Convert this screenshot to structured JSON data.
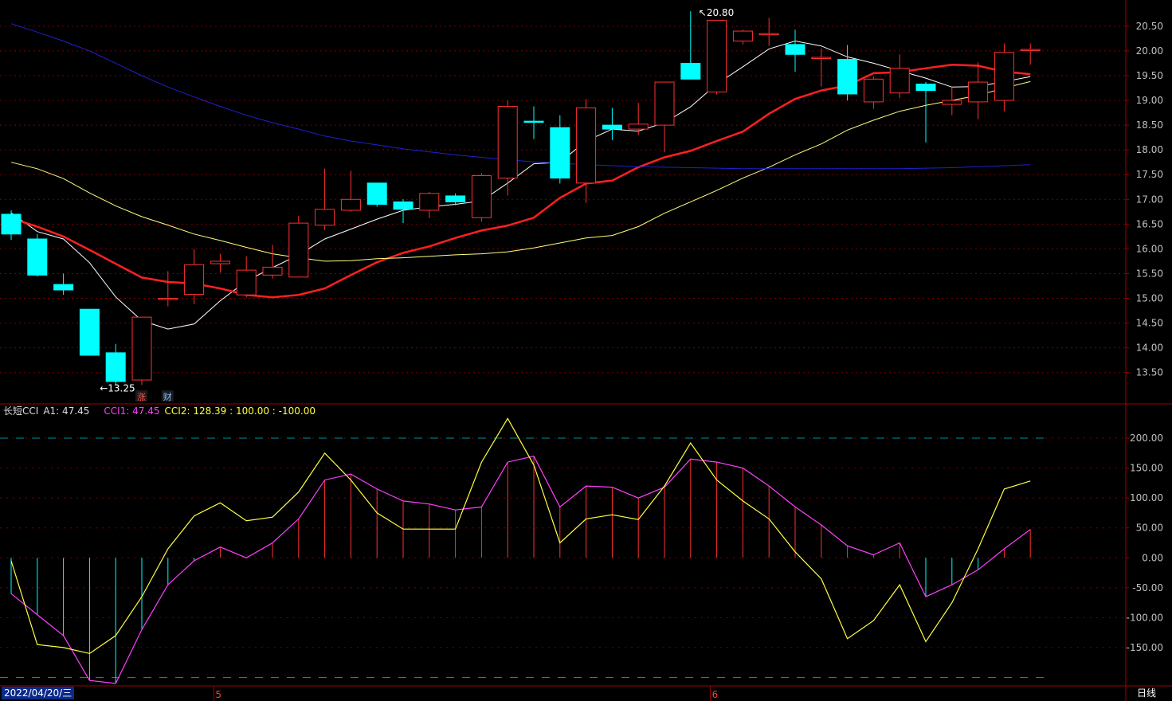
{
  "chart_data": [
    {
      "type": "candlestick",
      "name": "price",
      "y_ticks": [
        13.5,
        14.0,
        14.5,
        15.0,
        15.5,
        16.0,
        16.5,
        17.0,
        17.5,
        18.0,
        18.5,
        19.0,
        19.5,
        20.0,
        20.5
      ],
      "ylim": [
        12.9,
        20.9
      ],
      "candles": [
        {
          "o": 16.7,
          "h": 16.78,
          "c": 16.3,
          "l": 16.18
        },
        {
          "o": 16.2,
          "h": 16.3,
          "c": 15.47,
          "l": 15.44
        },
        {
          "o": 15.28,
          "h": 15.5,
          "c": 15.17,
          "l": 15.07
        },
        {
          "o": 14.78,
          "h": 14.78,
          "c": 13.85,
          "l": 13.85
        },
        {
          "o": 13.9,
          "h": 14.08,
          "c": 13.32,
          "l": 13.25
        },
        {
          "o": 13.35,
          "h": 14.62,
          "c": 14.62,
          "l": 13.25
        },
        {
          "o": 15.0,
          "h": 15.55,
          "c": 15.0,
          "l": 14.84
        },
        {
          "o": 15.08,
          "h": 16.0,
          "c": 15.68,
          "l": 14.88
        },
        {
          "o": 15.7,
          "h": 15.9,
          "c": 15.75,
          "l": 15.52
        },
        {
          "o": 15.07,
          "h": 15.85,
          "c": 15.57,
          "l": 15.02
        },
        {
          "o": 15.47,
          "h": 16.08,
          "c": 15.63,
          "l": 15.4
        },
        {
          "o": 15.43,
          "h": 16.67,
          "c": 16.52,
          "l": 15.43
        },
        {
          "o": 16.48,
          "h": 17.62,
          "c": 16.8,
          "l": 16.38
        },
        {
          "o": 16.78,
          "h": 17.58,
          "c": 17.0,
          "l": 16.75
        },
        {
          "o": 17.33,
          "h": 17.33,
          "c": 16.9,
          "l": 16.85
        },
        {
          "o": 16.95,
          "h": 17.0,
          "c": 16.8,
          "l": 16.52
        },
        {
          "o": 16.78,
          "h": 17.15,
          "c": 17.12,
          "l": 16.62
        },
        {
          "o": 17.07,
          "h": 17.12,
          "c": 16.95,
          "l": 16.88
        },
        {
          "o": 16.63,
          "h": 17.53,
          "c": 17.48,
          "l": 16.55
        },
        {
          "o": 17.43,
          "h": 19.0,
          "c": 18.88,
          "l": 17.08
        },
        {
          "o": 18.58,
          "h": 18.88,
          "c": 18.57,
          "l": 18.22
        },
        {
          "o": 18.45,
          "h": 18.7,
          "c": 17.43,
          "l": 17.32
        },
        {
          "o": 17.33,
          "h": 19.03,
          "c": 18.85,
          "l": 16.93
        },
        {
          "o": 18.5,
          "h": 18.85,
          "c": 18.42,
          "l": 18.2
        },
        {
          "o": 18.42,
          "h": 18.95,
          "c": 18.52,
          "l": 18.3
        },
        {
          "o": 18.5,
          "h": 19.37,
          "c": 19.37,
          "l": 17.95
        },
        {
          "o": 19.75,
          "h": 20.8,
          "c": 19.43,
          "l": 19.43
        },
        {
          "o": 19.17,
          "h": 20.62,
          "c": 20.62,
          "l": 19.12
        },
        {
          "o": 20.2,
          "h": 20.43,
          "c": 20.4,
          "l": 20.13
        },
        {
          "o": 20.35,
          "h": 20.67,
          "c": 20.35,
          "l": 20.1
        },
        {
          "o": 20.13,
          "h": 20.43,
          "c": 19.93,
          "l": 19.58
        },
        {
          "o": 19.87,
          "h": 20.05,
          "c": 19.87,
          "l": 19.28
        },
        {
          "o": 19.83,
          "h": 20.12,
          "c": 19.13,
          "l": 19.0
        },
        {
          "o": 18.97,
          "h": 19.48,
          "c": 19.43,
          "l": 18.83
        },
        {
          "o": 19.15,
          "h": 19.93,
          "c": 19.65,
          "l": 19.05
        },
        {
          "o": 19.33,
          "h": 19.37,
          "c": 19.2,
          "l": 18.15
        },
        {
          "o": 18.92,
          "h": 19.27,
          "c": 19.0,
          "l": 18.7
        },
        {
          "o": 18.97,
          "h": 19.77,
          "c": 19.37,
          "l": 18.62
        },
        {
          "o": 19.0,
          "h": 20.15,
          "c": 19.97,
          "l": 18.78
        },
        {
          "o": 20.03,
          "h": 20.15,
          "c": 20.03,
          "l": 19.72
        }
      ],
      "ma": [
        {
          "color": "#ffffff",
          "width": 1,
          "values": [
            16.73,
            16.35,
            16.2,
            15.72,
            15.03,
            14.55,
            14.38,
            14.48,
            14.95,
            15.35,
            15.62,
            15.88,
            16.2,
            16.4,
            16.6,
            16.78,
            16.85,
            16.9,
            16.97,
            17.33,
            17.72,
            17.75,
            18.18,
            18.42,
            18.38,
            18.55,
            18.87,
            19.33,
            19.68,
            20.04,
            20.2,
            20.1,
            19.88,
            19.75,
            19.6,
            19.45,
            19.27,
            19.28,
            19.38,
            19.48
          ]
        },
        {
          "color": "#ff2020",
          "width": 2.5,
          "values": [
            16.62,
            16.45,
            16.25,
            15.98,
            15.7,
            15.42,
            15.33,
            15.3,
            15.2,
            15.07,
            15.02,
            15.07,
            15.2,
            15.47,
            15.73,
            15.92,
            16.05,
            16.22,
            16.37,
            16.47,
            16.63,
            17.03,
            17.32,
            17.38,
            17.65,
            17.85,
            17.98,
            18.18,
            18.37,
            18.73,
            19.03,
            19.2,
            19.3,
            19.55,
            19.57,
            19.65,
            19.72,
            19.7,
            19.58,
            19.53
          ]
        },
        {
          "color": "#ffff80",
          "width": 1,
          "values": [
            17.75,
            17.62,
            17.42,
            17.13,
            16.87,
            16.65,
            16.48,
            16.3,
            16.17,
            16.03,
            15.9,
            15.82,
            15.75,
            15.76,
            15.8,
            15.82,
            15.85,
            15.88,
            15.9,
            15.94,
            16.02,
            16.12,
            16.22,
            16.27,
            16.45,
            16.72,
            16.95,
            17.18,
            17.43,
            17.65,
            17.9,
            18.12,
            18.4,
            18.6,
            18.78,
            18.9,
            19.0,
            19.1,
            19.25,
            19.38
          ]
        },
        {
          "color": "#2020d0",
          "width": 1,
          "values": [
            20.55,
            20.38,
            20.2,
            20.0,
            19.75,
            19.5,
            19.27,
            19.07,
            18.88,
            18.7,
            18.55,
            18.42,
            18.28,
            18.18,
            18.1,
            18.02,
            17.96,
            17.9,
            17.85,
            17.8,
            17.76,
            17.73,
            17.7,
            17.68,
            17.66,
            17.65,
            17.64,
            17.63,
            17.62,
            17.62,
            17.62,
            17.62,
            17.62,
            17.62,
            17.62,
            17.63,
            17.64,
            17.66,
            17.68,
            17.7
          ]
        }
      ],
      "annotations": [
        {
          "text": "20.80",
          "candle": 26
        },
        {
          "text": "13.25",
          "candle": 4
        }
      ],
      "event_markers": [
        {
          "text": "涨",
          "candle": 5,
          "color": "#ff5050"
        },
        {
          "text": "财",
          "candle": 6,
          "color": "#80c0ff"
        }
      ]
    },
    {
      "type": "indicator",
      "name": "长短CCI",
      "ylim": [
        -210,
        240
      ],
      "y_ticks": [
        -150.0,
        -100.0,
        -50.0,
        0.0,
        50.0,
        100.0,
        150.0,
        200.0
      ],
      "reference_levels": [
        200,
        -200
      ],
      "cci1": [
        -60,
        -95,
        -130,
        -205,
        -210,
        -120,
        -45,
        -5,
        18,
        0,
        25,
        65,
        130,
        140,
        115,
        95,
        90,
        80,
        85,
        160,
        170,
        85,
        120,
        118,
        100,
        118,
        165,
        160,
        150,
        120,
        85,
        55,
        20,
        5,
        25,
        -65,
        -45,
        -20,
        15,
        47.45
      ],
      "cci2": [
        -5,
        -145,
        -150,
        -160,
        -130,
        -65,
        15,
        70,
        92,
        62,
        68,
        110,
        175,
        130,
        75,
        48,
        48,
        48,
        160,
        233,
        155,
        25,
        65,
        72,
        64,
        120,
        192,
        130,
        95,
        65,
        10,
        -35,
        -135,
        -105,
        -45,
        -140,
        -75,
        15,
        115,
        128.39
      ]
    }
  ],
  "legend": {
    "name": "长短CCI",
    "a1": "A1: 47.45",
    "cci1": "CCI1: 47.45",
    "cci2": "CCI2: 128.39 : 100.00 : -100.00"
  },
  "x_axis": {
    "start_date": "2022/04/20/三",
    "month_marks": [
      {
        "text": "5",
        "candle": 8
      },
      {
        "text": "6",
        "candle": 27
      }
    ],
    "period": "日线"
  },
  "colors": {
    "up": "#ff3030",
    "down": "#00ffff",
    "cci1": "#ff40ff",
    "cci2": "#ffff40",
    "grid": "#7a0000",
    "axis": "#a00000",
    "axis_text": "#c0c0c0",
    "ref_line": "#009090"
  }
}
